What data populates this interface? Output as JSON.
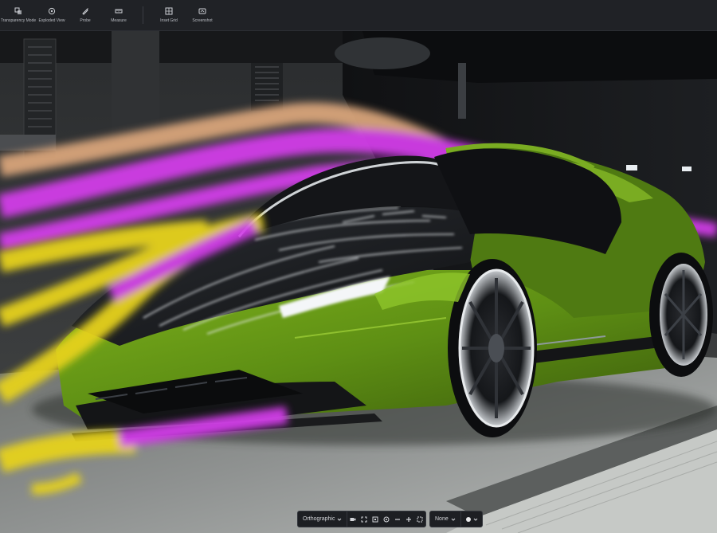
{
  "toolbar": {
    "items": [
      {
        "label": "Transparency Mode",
        "icon": "transparency-icon"
      },
      {
        "label": "Exploded View",
        "icon": "exploded-view-icon"
      },
      {
        "label": "Probe",
        "icon": "probe-icon"
      },
      {
        "label": "Measure",
        "icon": "measure-icon"
      },
      {
        "label": "Inset Grid",
        "icon": "grid-icon"
      },
      {
        "label": "Screenshot",
        "icon": "screenshot-icon"
      }
    ]
  },
  "viewport": {
    "subject": "wind tunnel car render",
    "colors": {
      "car_body": "#5e8f14",
      "flow_magenta": "#d23ee8",
      "flow_yellow": "#e6d21e",
      "flow_peach": "#d8a47a"
    }
  },
  "viewbar": {
    "projection": "Orthographic",
    "background": "None",
    "icons": [
      "camera-icon",
      "fit-view-icon",
      "frame-icon",
      "target-icon",
      "zoom-out-icon",
      "zoom-in-icon",
      "fullscreen-icon"
    ]
  }
}
